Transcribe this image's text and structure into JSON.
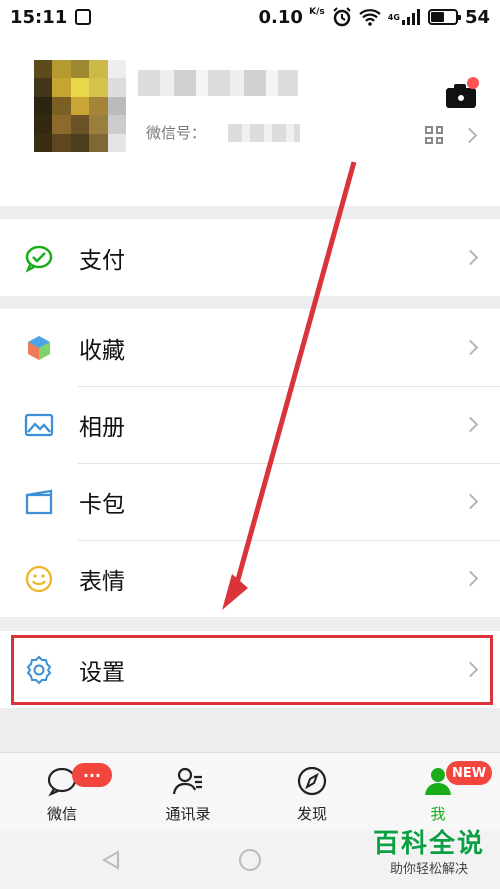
{
  "status_bar": {
    "time": "15:11",
    "net_speed": "0.10",
    "net_unit": "K/s",
    "network": "4G",
    "battery": "54"
  },
  "profile": {
    "wechat_id_label": "微信号："
  },
  "menu": [
    {
      "label": "支付",
      "icon": "payment-icon"
    },
    {
      "label": "收藏",
      "icon": "favorites-icon"
    },
    {
      "label": "相册",
      "icon": "album-icon"
    },
    {
      "label": "卡包",
      "icon": "card-wallet-icon"
    },
    {
      "label": "表情",
      "icon": "sticker-icon"
    },
    {
      "label": "设置",
      "icon": "settings-icon"
    }
  ],
  "tabs": [
    {
      "label": "微信",
      "badge": "···"
    },
    {
      "label": "通讯录"
    },
    {
      "label": "发现"
    },
    {
      "label": "我",
      "badge": "NEW"
    }
  ],
  "watermark": {
    "title": "百科全说",
    "subtitle": "助你轻松解决"
  },
  "colors": {
    "accent_green": "#1aad19",
    "badge_red": "#f2453d",
    "highlight_red": "#d9343a"
  }
}
